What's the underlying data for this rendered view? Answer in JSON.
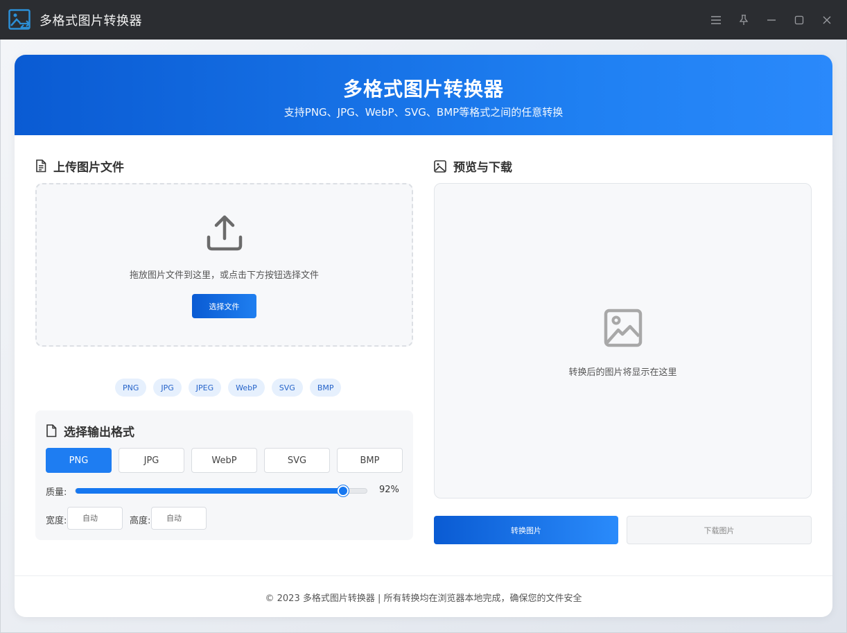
{
  "window": {
    "title": "多格式图片转换器",
    "controls": [
      "menu-icon",
      "pin-icon",
      "minimize-icon",
      "maximize-icon",
      "close-icon"
    ]
  },
  "hero": {
    "title": "多格式图片转换器",
    "subtitle": "支持PNG、JPG、WebP、SVG、BMP等格式之间的任意转换"
  },
  "upload": {
    "title": "上传图片文件",
    "hint": "拖放图片文件到这里，或点击下方按钮选择文件",
    "button": "选择文件",
    "supported": [
      "PNG",
      "JPG",
      "JPEG",
      "WebP",
      "SVG",
      "BMP"
    ]
  },
  "output": {
    "title": "选择输出格式",
    "formats": [
      "PNG",
      "JPG",
      "WebP",
      "SVG",
      "BMP"
    ],
    "selected": "PNG",
    "quality_label": "质量:",
    "quality_value": 92,
    "quality_display": "92%",
    "width_label": "宽度:",
    "width_placeholder": "自动",
    "height_label": "高度:",
    "height_placeholder": "自动"
  },
  "preview": {
    "title": "预览与下载",
    "hint": "转换后的图片将显示在这里",
    "convert_button": "转换图片",
    "download_button": "下载图片"
  },
  "footer": {
    "text": "© 2023 多格式图片转换器 | 所有转换均在浏览器本地完成，确保您的文件安全"
  },
  "colors": {
    "accent": "#1e7df2",
    "titlebar": "#2b2d31",
    "hero_start": "#0a5bd3",
    "hero_end": "#2a89fb"
  }
}
